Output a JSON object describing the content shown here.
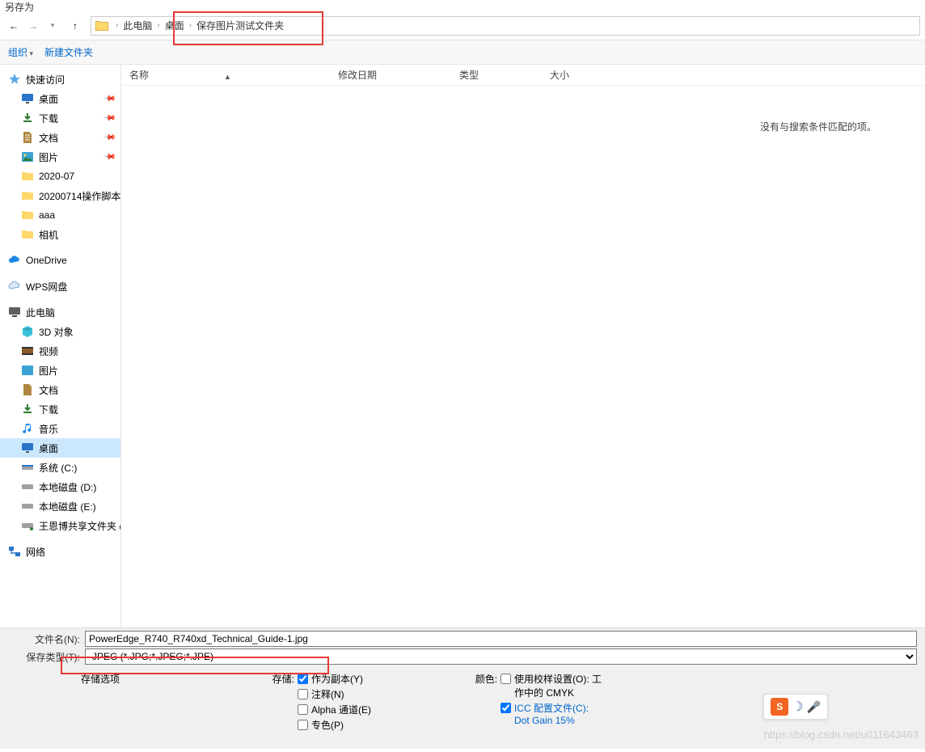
{
  "window_title": "另存为",
  "breadcrumbs": [
    "此电脑",
    "桌面",
    "保存图片测试文件夹"
  ],
  "toolbar": {
    "organize": "组织",
    "new_folder": "新建文件夹"
  },
  "columns": {
    "name": "名称",
    "date": "修改日期",
    "type": "类型",
    "size": "大小"
  },
  "empty_message": "没有与搜索条件匹配的项。",
  "sidebar": {
    "quick_access": {
      "label": "快速访问",
      "pinned": [
        {
          "label": "桌面",
          "icon": "desktop"
        },
        {
          "label": "下载",
          "icon": "download"
        },
        {
          "label": "文档",
          "icon": "document"
        },
        {
          "label": "图片",
          "icon": "picture"
        }
      ],
      "recent": [
        {
          "label": "2020-07",
          "icon": "folder"
        },
        {
          "label": "20200714操作脚本",
          "icon": "folder"
        },
        {
          "label": "aaa",
          "icon": "folder"
        },
        {
          "label": "相机",
          "icon": "folder"
        }
      ]
    },
    "onedrive": "OneDrive",
    "wps": "WPS网盘",
    "this_pc": {
      "label": "此电脑",
      "children": [
        {
          "label": "3D 对象",
          "icon": "cube"
        },
        {
          "label": "视频",
          "icon": "video"
        },
        {
          "label": "图片",
          "icon": "picture"
        },
        {
          "label": "文档",
          "icon": "document"
        },
        {
          "label": "下载",
          "icon": "download"
        },
        {
          "label": "音乐",
          "icon": "music"
        },
        {
          "label": "桌面",
          "icon": "desktop",
          "selected": true
        },
        {
          "label": "系统 (C:)",
          "icon": "drive"
        },
        {
          "label": "本地磁盘 (D:)",
          "icon": "drive"
        },
        {
          "label": "本地磁盘 (E:)",
          "icon": "drive"
        },
        {
          "label": "王恩博共享文件夹 (",
          "icon": "netdrive"
        }
      ]
    },
    "network": "网络"
  },
  "file": {
    "name_label": "文件名(N):",
    "name_value": "PowerEdge_R740_R740xd_Technical_Guide-1.jpg",
    "type_label": "保存类型(T):",
    "type_value": "JPEG (*.JPG;*.JPEG;*.JPE)"
  },
  "options": {
    "storage_options": "存储选项",
    "save_label": "存储:",
    "save_items": [
      {
        "label": "作为副本(Y)",
        "checked": true
      },
      {
        "label": "注释(N)",
        "checked": false
      },
      {
        "label": "Alpha 通道(E)",
        "checked": false
      },
      {
        "label": "专色(P)",
        "checked": false
      }
    ],
    "color_label": "颜色:",
    "color_items": [
      {
        "label_line1": "使用校样设置(O): 工",
        "label_line2": "作中的 CMYK",
        "checked": false,
        "link": false
      },
      {
        "label_line1": "ICC 配置文件(C):",
        "label_line2": "Dot Gain 15%",
        "checked": true,
        "link": true
      }
    ]
  },
  "watermark": "https://blog.csdn.net/u011643463"
}
